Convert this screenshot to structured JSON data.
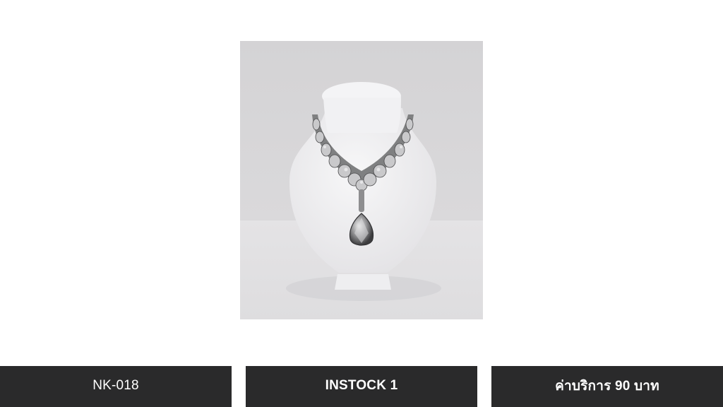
{
  "product": {
    "image_subject": "silver rhinestone necklace on white bust display"
  },
  "info_bars": {
    "code": "NK-018",
    "stock": "INSTOCK 1",
    "price": "ค่าบริการ 90 บาท"
  },
  "colors": {
    "bar_background": "#2a2a2b",
    "bar_text": "#ffffff",
    "page_background": "#ffffff"
  }
}
